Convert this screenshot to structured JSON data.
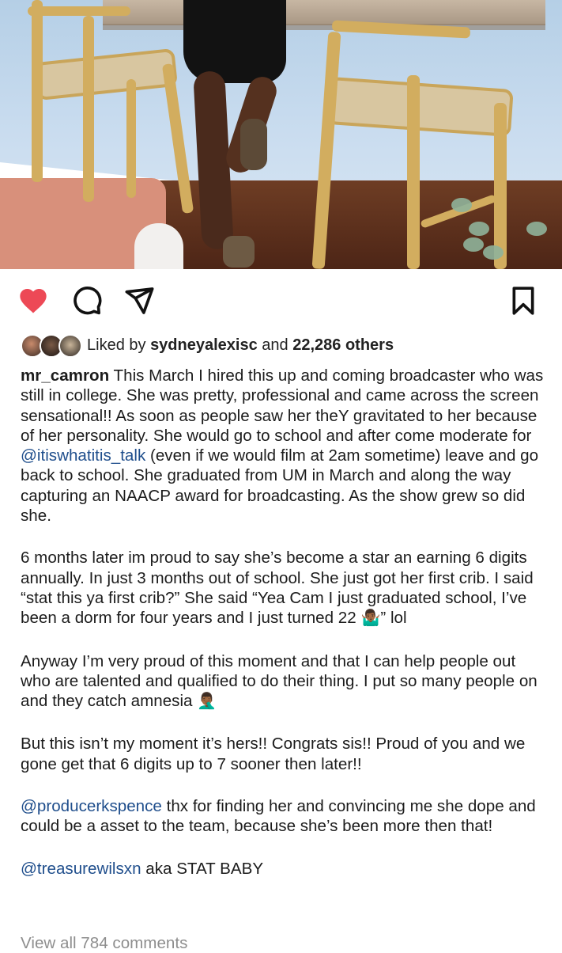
{
  "post": {
    "photo_description_icon": "photo",
    "liked_by_prefix": "Liked by",
    "liked_by_user": "sydneyalexisc",
    "liked_by_and": "and",
    "liked_by_count": "22,286 others",
    "author": "mr_camron",
    "caption": {
      "p1": "This March I hired this up and coming broadcaster who was still in college. She was pretty, professional and came across the screen sensational!! As soon as people saw her theY gravitated to her because of her personality. She would go to school and after come moderate for",
      "p1_mention": "@itiswhatitis_talk",
      "p1_tail": "(even if we would film at 2am sometime) leave and go back to school. She graduated from UM in March and along the way capturing an NAACP award for broadcasting. As the show grew so did she.",
      "p2": "6 months later im proud to say she’s become a star an earning 6 digits annually. In just 3 months out of school. She just got her first crib. I said “stat this ya first crib?” She said “Yea Cam I just graduated school, I’ve been a dorm for four years and I just turned 22",
      "p2_emoji": "🤷🏾‍♂️",
      "p2_tail": "” lol",
      "p3": "Anyway I’m very proud of this moment and that I can help people out who are talented and qualified to do their thing. I put so many people on and they catch amnesia",
      "p3_emoji": "🤦🏾‍♂️",
      "p4": "But this isn’t my moment it’s hers!! Congrats sis!! Proud of you and we gone get that 6 digits up to 7 sooner then later!!",
      "p5_mention": "@producerkspence",
      "p5": "thx for finding her and convincing me she dope and could be a asset to the team, because she’s been more then that!",
      "p6_mention": "@treasurewilsxn",
      "p6": "aka STAT BABY"
    },
    "view_all": "View all 784 comments"
  },
  "colors": {
    "heart": "#ed4956",
    "mention": "#1f4e8c",
    "muted": "#8e8e8e"
  },
  "icons": [
    "heart-icon",
    "comment-icon",
    "share-icon",
    "bookmark-icon"
  ]
}
